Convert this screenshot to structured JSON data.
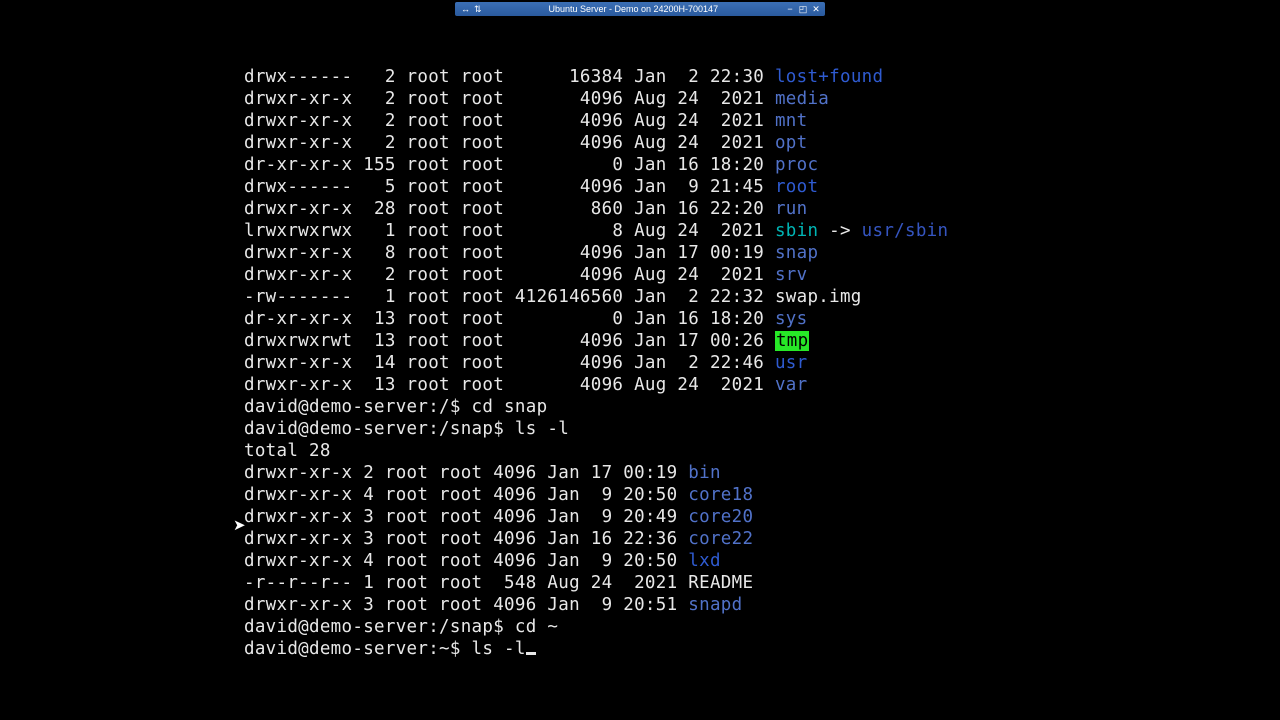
{
  "window": {
    "title": "Ubuntu Server - Demo on 24200H-700147",
    "icons": {
      "left1": "↔",
      "left2": "⇅"
    },
    "buttons": {
      "min": "−",
      "max": "◰",
      "close": "✕"
    }
  },
  "root_ls": [
    {
      "perm": "drwx------",
      "n": "  2",
      "own": "root root",
      "size": "     16384",
      "date": "Jan  2 22:30",
      "name": "lost+found",
      "cls": "dir"
    },
    {
      "perm": "drwxr-xr-x",
      "n": "  2",
      "own": "root root",
      "size": "      4096",
      "date": "Aug 24  2021",
      "name": "media",
      "cls": "dirb"
    },
    {
      "perm": "drwxr-xr-x",
      "n": "  2",
      "own": "root root",
      "size": "      4096",
      "date": "Aug 24  2021",
      "name": "mnt",
      "cls": "dirb"
    },
    {
      "perm": "drwxr-xr-x",
      "n": "  2",
      "own": "root root",
      "size": "      4096",
      "date": "Aug 24  2021",
      "name": "opt",
      "cls": "dirb"
    },
    {
      "perm": "dr-xr-xr-x",
      "n": "155",
      "own": "root root",
      "size": "         0",
      "date": "Jan 16 18:20",
      "name": "proc",
      "cls": "dirb"
    },
    {
      "perm": "drwx------",
      "n": "  5",
      "own": "root root",
      "size": "      4096",
      "date": "Jan  9 21:45",
      "name": "root",
      "cls": "dir"
    },
    {
      "perm": "drwxr-xr-x",
      "n": " 28",
      "own": "root root",
      "size": "       860",
      "date": "Jan 16 22:20",
      "name": "run",
      "cls": "dirb"
    },
    {
      "perm": "lrwxrwxrwx",
      "n": "  1",
      "own": "root root",
      "size": "         8",
      "date": "Aug 24  2021",
      "name": "sbin",
      "cls": "link",
      "arrow": " -> ",
      "target": "usr/sbin"
    },
    {
      "perm": "drwxr-xr-x",
      "n": "  8",
      "own": "root root",
      "size": "      4096",
      "date": "Jan 17 00:19",
      "name": "snap",
      "cls": "dirb"
    },
    {
      "perm": "drwxr-xr-x",
      "n": "  2",
      "own": "root root",
      "size": "      4096",
      "date": "Aug 24  2021",
      "name": "srv",
      "cls": "dirb"
    },
    {
      "perm": "-rw-------",
      "n": "  1",
      "own": "root root",
      "size": "4126146560",
      "date": "Jan  2 22:32",
      "name": "swap.img",
      "cls": ""
    },
    {
      "perm": "dr-xr-xr-x",
      "n": " 13",
      "own": "root root",
      "size": "         0",
      "date": "Jan 16 18:20",
      "name": "sys",
      "cls": "dirb"
    },
    {
      "perm": "drwxrwxrwt",
      "n": " 13",
      "own": "root root",
      "size": "      4096",
      "date": "Jan 17 00:26",
      "name": "tmp",
      "cls": "sticky"
    },
    {
      "perm": "drwxr-xr-x",
      "n": " 14",
      "own": "root root",
      "size": "      4096",
      "date": "Jan  2 22:46",
      "name": "usr",
      "cls": "dir"
    },
    {
      "perm": "drwxr-xr-x",
      "n": " 13",
      "own": "root root",
      "size": "      4096",
      "date": "Aug 24  2021",
      "name": "var",
      "cls": "dirb"
    }
  ],
  "prompt1": {
    "text": "david@demo-server:/$ ",
    "cmd": "cd snap"
  },
  "prompt2": {
    "text": "david@demo-server:/snap$ ",
    "cmd": "ls -l"
  },
  "total": "total 28",
  "snap_ls": [
    {
      "perm": "drwxr-xr-x",
      "n": "2",
      "own": "root root",
      "size": "4096",
      "date": "Jan 17 00:19",
      "name": "bin",
      "cls": "dirb"
    },
    {
      "perm": "drwxr-xr-x",
      "n": "4",
      "own": "root root",
      "size": "4096",
      "date": "Jan  9 20:50",
      "name": "core18",
      "cls": "dirb"
    },
    {
      "perm": "drwxr-xr-x",
      "n": "3",
      "own": "root root",
      "size": "4096",
      "date": "Jan  9 20:49",
      "name": "core20",
      "cls": "dirb"
    },
    {
      "perm": "drwxr-xr-x",
      "n": "3",
      "own": "root root",
      "size": "4096",
      "date": "Jan 16 22:36",
      "name": "core22",
      "cls": "dirb"
    },
    {
      "perm": "drwxr-xr-x",
      "n": "4",
      "own": "root root",
      "size": "4096",
      "date": "Jan  9 20:50",
      "name": "lxd",
      "cls": "dir"
    },
    {
      "perm": "-r--r--r--",
      "n": "1",
      "own": "root root",
      "size": " 548",
      "date": "Aug 24  2021",
      "name": "README",
      "cls": ""
    },
    {
      "perm": "drwxr-xr-x",
      "n": "3",
      "own": "root root",
      "size": "4096",
      "date": "Jan  9 20:51",
      "name": "snapd",
      "cls": "dirb"
    }
  ],
  "prompt3": {
    "text": "david@demo-server:/snap$ ",
    "cmd": "cd ~"
  },
  "prompt4": {
    "text": "david@demo-server:~$ ",
    "cmd": "ls -l"
  }
}
